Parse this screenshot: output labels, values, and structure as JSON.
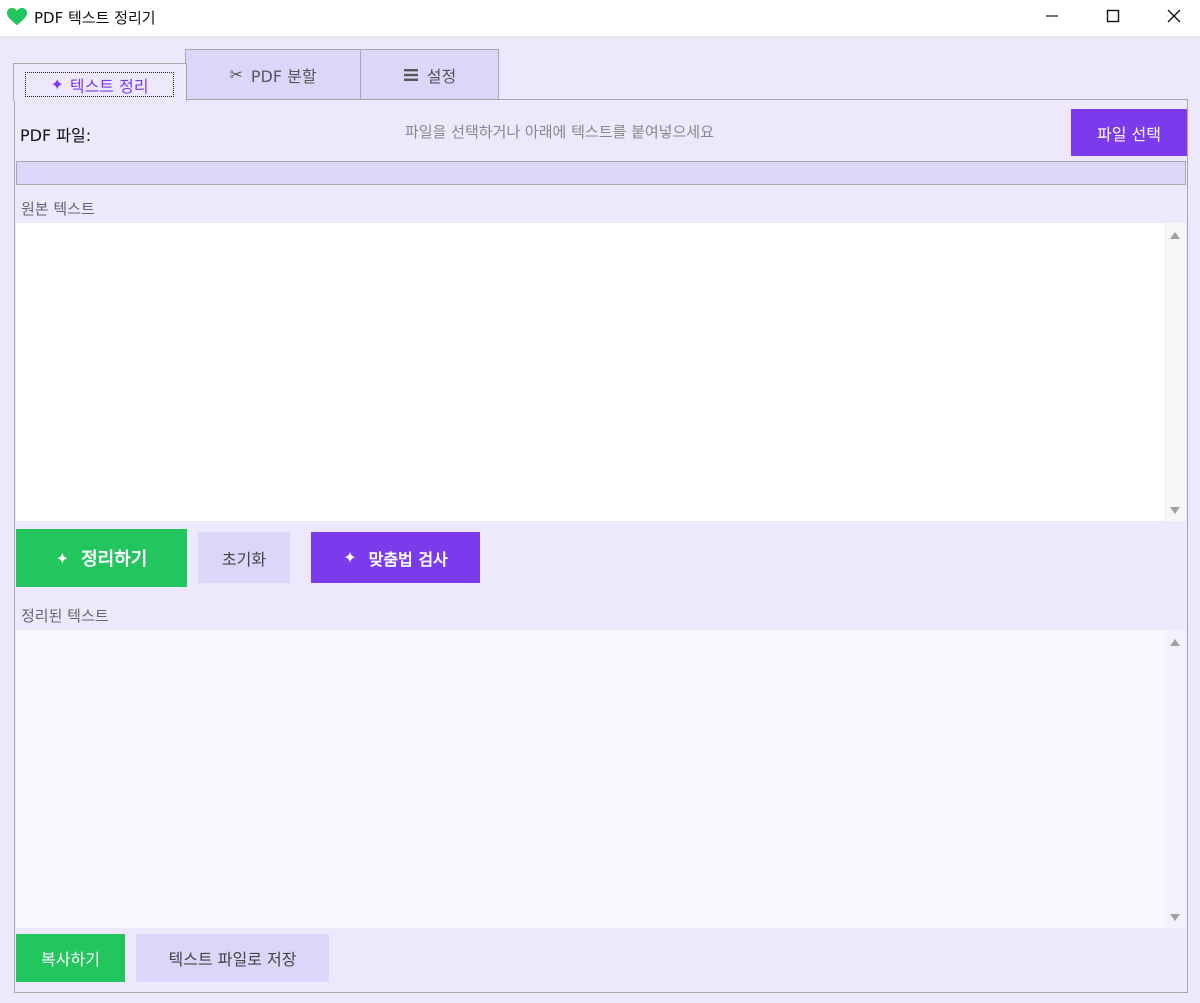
{
  "window": {
    "title": "PDF 텍스트 정리기",
    "accent": "#7c3aed",
    "icon": "green-heart-icon"
  },
  "tabs": [
    {
      "label": "텍스트 정리",
      "icon": "sparkle-icon",
      "active": true
    },
    {
      "label": "PDF 분할",
      "icon": "scissors-icon"
    },
    {
      "label": "설정",
      "icon": "menu-icon"
    }
  ],
  "file": {
    "label": "PDF 파일:",
    "hint": "파일을 선택하거나 아래에 텍스트를 붙여넣으세요",
    "button": "파일 선택"
  },
  "progress": {
    "value": 0
  },
  "source": {
    "label": "원본 텍스트",
    "text": ""
  },
  "actions": {
    "clean": "정리하기",
    "reset": "초기화",
    "spellcheck": "맞춤법 검사"
  },
  "result": {
    "label": "정리된 텍스트",
    "text": ""
  },
  "footer": {
    "copy": "복사하기",
    "save": "텍스트 파일로 저장"
  },
  "colors": {
    "green": "#22c55e",
    "purple": "#7c3aed",
    "background": "#eee8fd",
    "light_button": "#ddd6fa"
  }
}
